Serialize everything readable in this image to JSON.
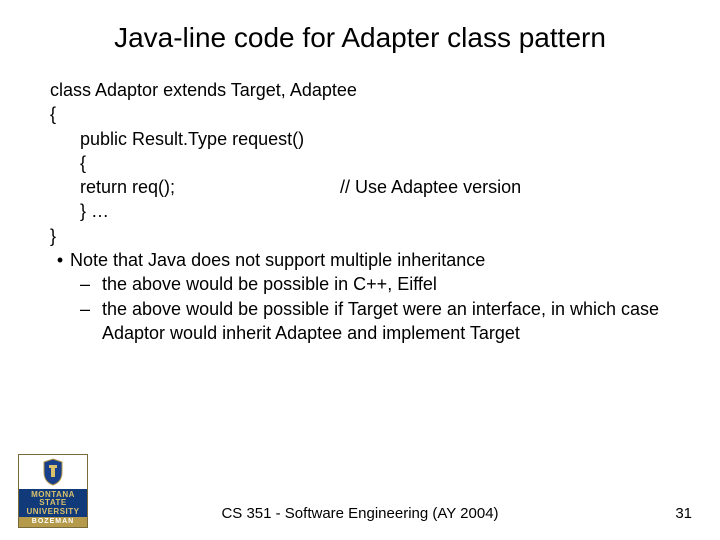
{
  "title": "Java-line code for Adapter class pattern",
  "code": {
    "l1": "class Adaptor extends Target, Adaptee",
    "l2": "{",
    "l3": "public Result.Type request()",
    "l4": "{",
    "l5a": "return req();",
    "l5b": "// Use Adaptee version",
    "l6": "} …",
    "l7": "}"
  },
  "bullet": {
    "dot": "•",
    "text": "Note that Java does not support multiple inheritance",
    "sub": [
      {
        "dash": "–",
        "text": "the above would be possible in C++, Eiffel"
      },
      {
        "dash": "–",
        "text": "the above would be possible if Target were an interface, in which case Adaptor would inherit Adaptee and implement Target"
      }
    ]
  },
  "logo": {
    "line1": "MONTANA",
    "line2": "STATE UNIVERSITY",
    "bottom": "BOZEMAN"
  },
  "footer": "CS 351 - Software Engineering (AY 2004)",
  "page": "31"
}
